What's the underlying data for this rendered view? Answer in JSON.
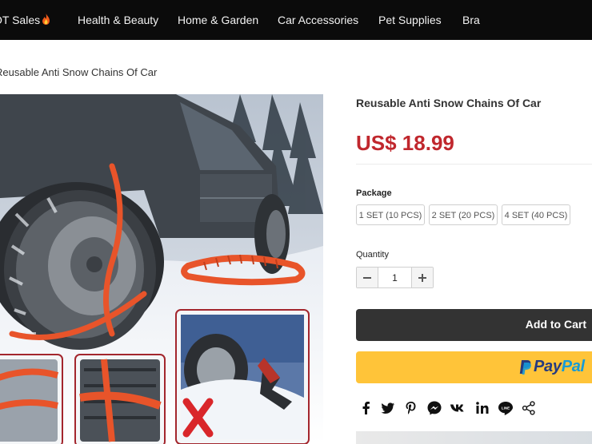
{
  "nav": {
    "items": [
      {
        "label": "OT Sales"
      },
      {
        "label": "Health & Beauty"
      },
      {
        "label": "Home & Garden"
      },
      {
        "label": "Car Accessories"
      },
      {
        "label": "Pet Supplies"
      },
      {
        "label": "Bra"
      }
    ]
  },
  "breadcrumb": "Reusable Anti Snow Chains Of Car",
  "product": {
    "title": "Reusable Anti Snow Chains Of Car",
    "price": "US$ 18.99",
    "package_label": "Package",
    "package_options": [
      "1 SET (10 PCS)",
      "2 SET (20 PCS)",
      "4 SET (40 PCS)"
    ],
    "quantity_label": "Quantity",
    "quantity_value": "1",
    "add_to_cart": "Add to Cart",
    "paypal_part1": "Pay",
    "paypal_part2": "Pal"
  },
  "share": {
    "icons": [
      "facebook-icon",
      "twitter-icon",
      "pinterest-icon",
      "messenger-icon",
      "vk-icon",
      "linkedin-icon",
      "line-icon",
      "share-icon"
    ]
  },
  "colors": {
    "nav_bg": "#0b0b0b",
    "price": "#c0272d",
    "cart_bg": "#333333",
    "paypal_bg": "#ffc439",
    "paypal_dark": "#253b80",
    "paypal_light": "#179bd7",
    "chain_orange": "#e8542a"
  }
}
